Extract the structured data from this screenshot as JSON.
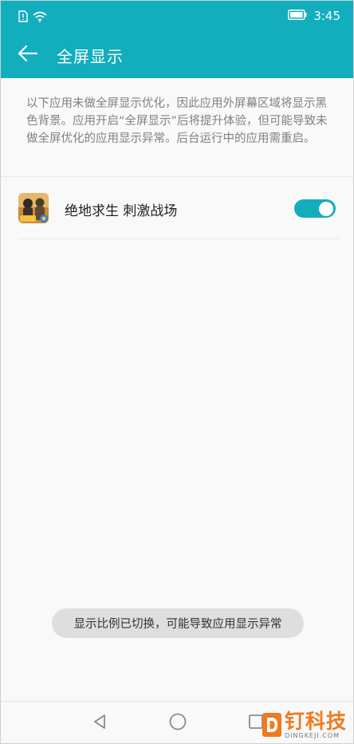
{
  "status_bar": {
    "time": "3:45",
    "icons": [
      "sim-alert-icon",
      "wifi-icon",
      "battery-icon"
    ]
  },
  "header": {
    "title": "全屏显示",
    "back_icon": "arrow-left-icon"
  },
  "description": "以下应用未做全屏显示优化，因此应用外屏幕区域将显示黑色背景。应用开启“全屏显示”后将提升体验，但可能导致未做全屏优化的应用显示异常。后台运行中的应用需重启。",
  "apps": [
    {
      "name": "绝地求生 刺激战场",
      "enabled": true
    }
  ],
  "toast": "显示比例已切换，可能导致应用显示异常",
  "nav_bar": {
    "buttons": [
      "back-triangle-icon",
      "home-circle-icon",
      "recents-square-icon"
    ]
  },
  "watermark": {
    "text_cn": "钉科技",
    "text_en": "DINGKEJI.COM"
  },
  "colors": {
    "accent": "#12aebe",
    "toast_bg": "#dedede",
    "watermark": "#f07a1e"
  }
}
